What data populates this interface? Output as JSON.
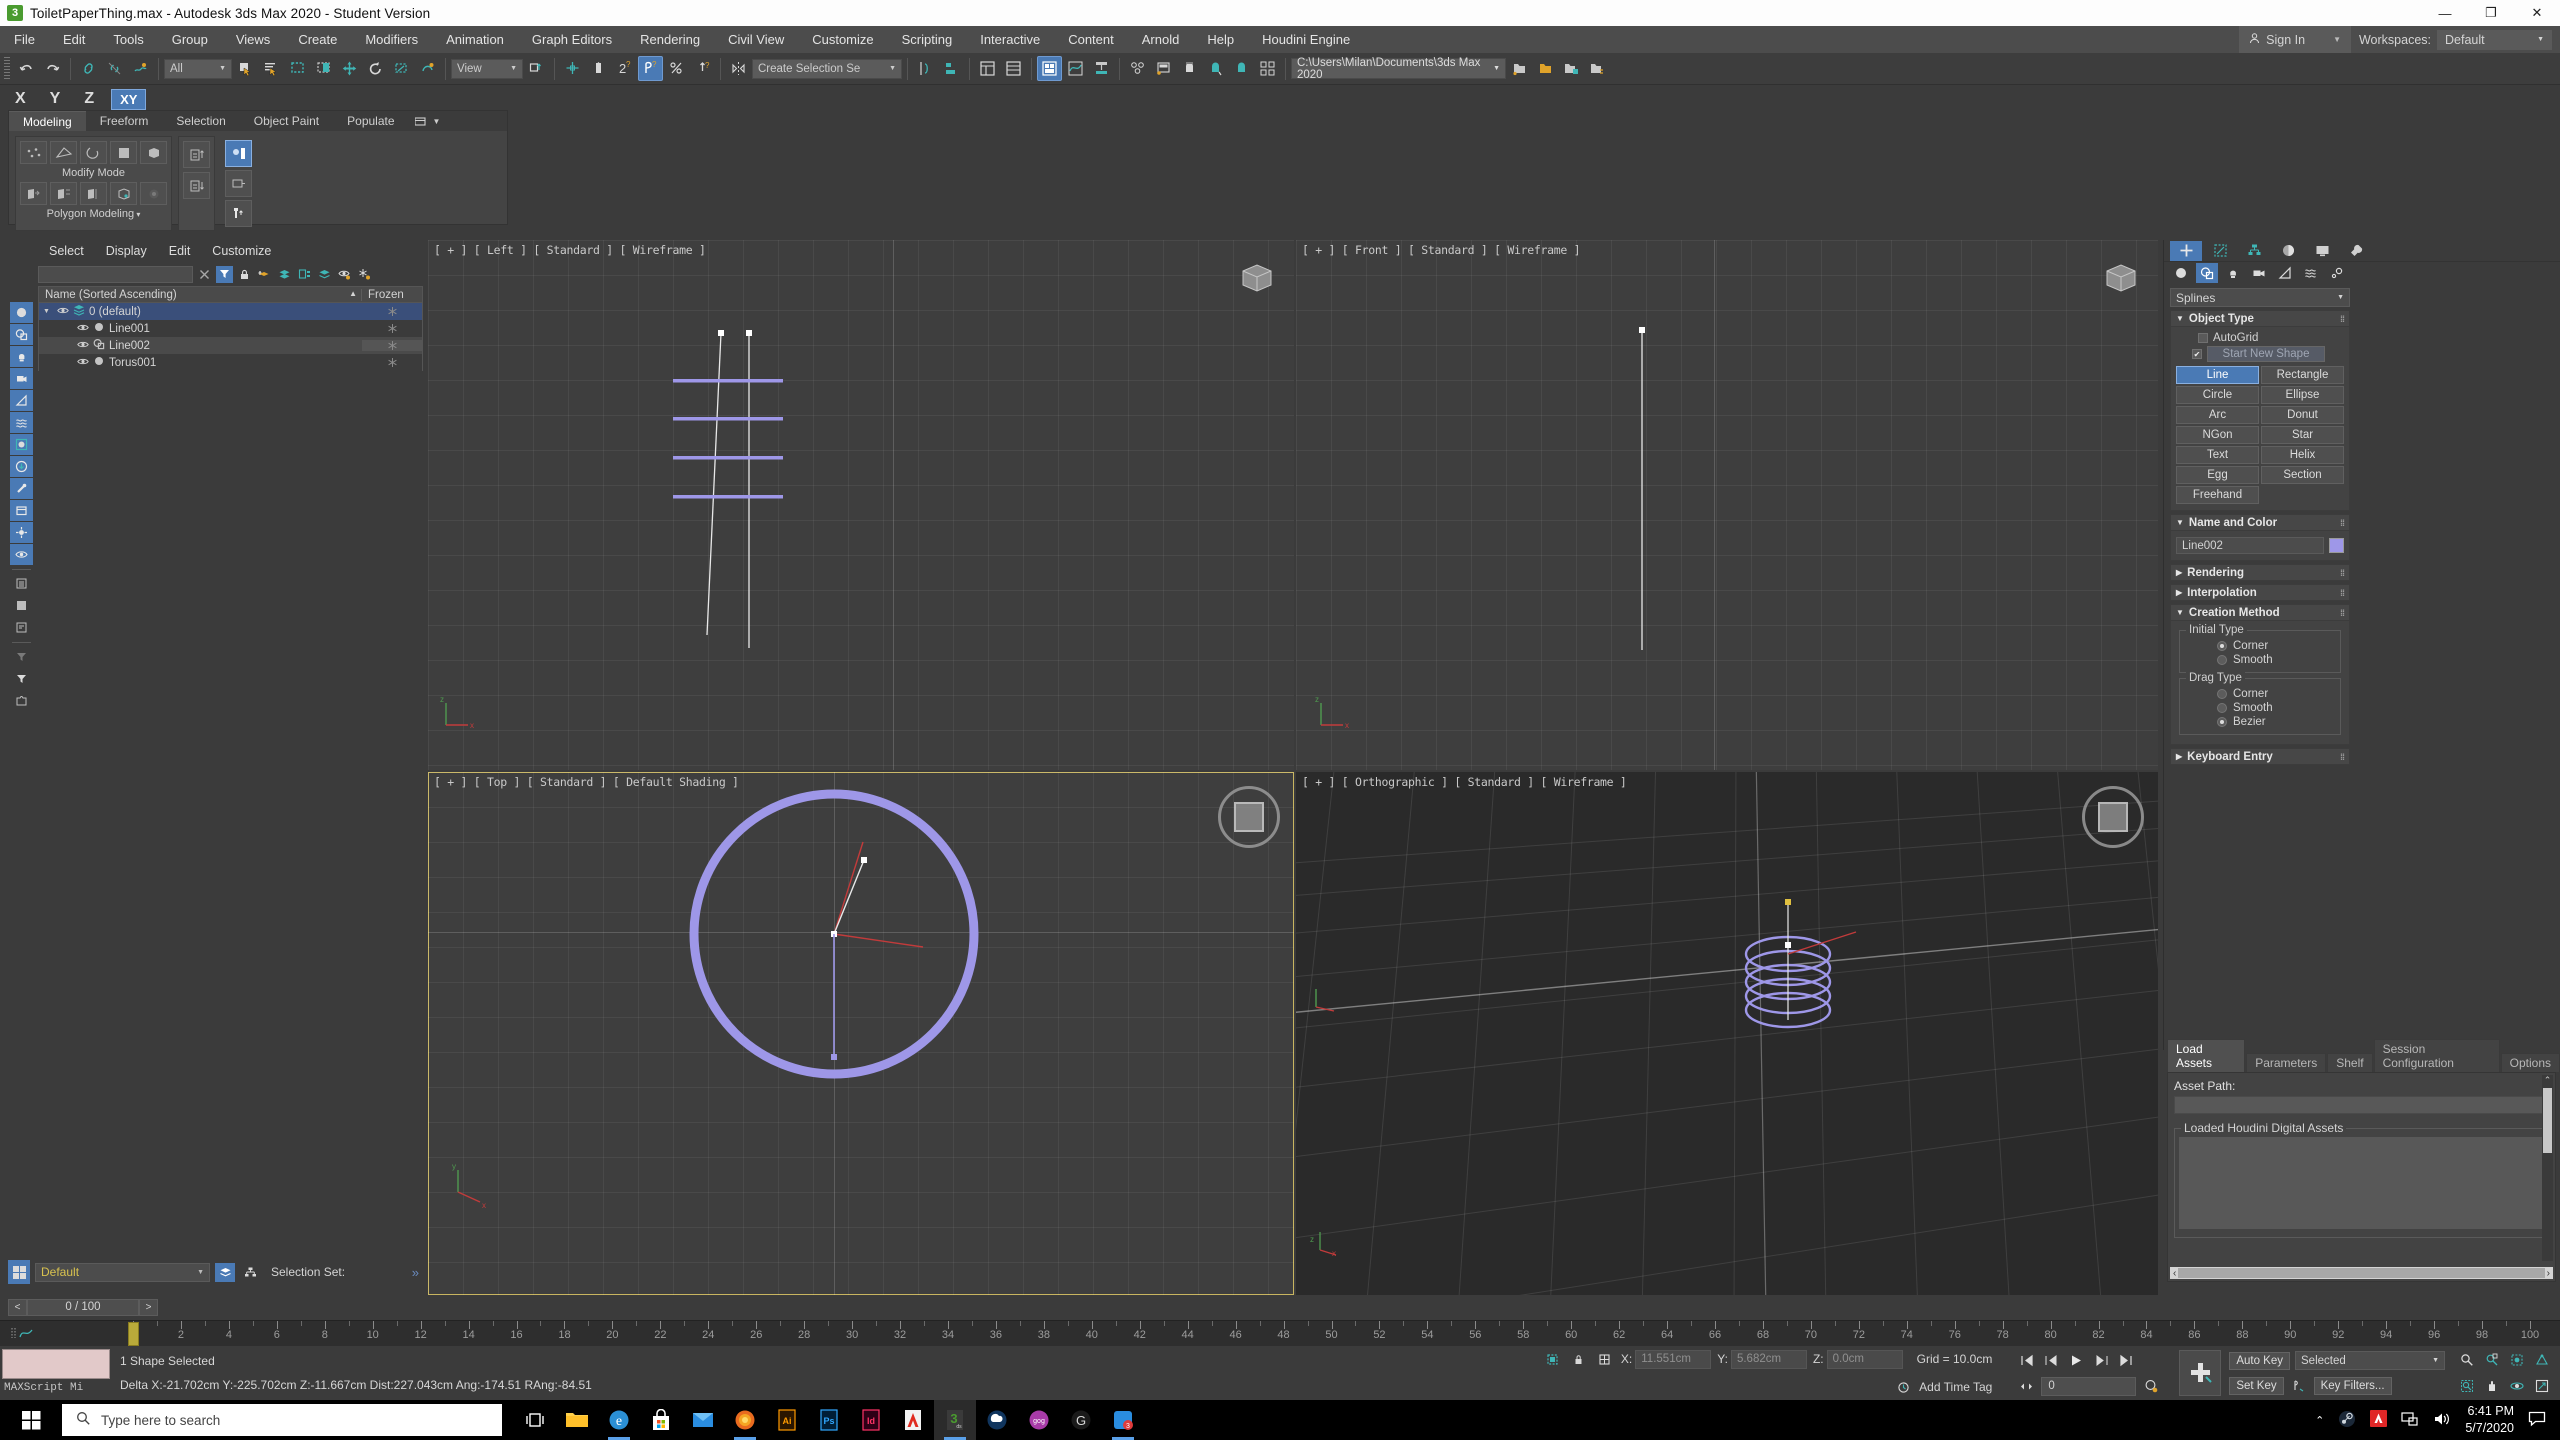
{
  "window": {
    "title": "ToiletPaperThing.max - Autodesk 3ds Max 2020 - Student Version",
    "app_badge": "3",
    "minimize": "—",
    "maximize": "❐",
    "close": "✕"
  },
  "menu": {
    "items": [
      "File",
      "Edit",
      "Tools",
      "Group",
      "Views",
      "Create",
      "Modifiers",
      "Animation",
      "Graph Editors",
      "Rendering",
      "Civil View",
      "Customize",
      "Scripting",
      "Interactive",
      "Content",
      "Arnold",
      "Help",
      "Houdini Engine"
    ],
    "signin_label": "Sign In",
    "workspaces_label": "Workspaces:",
    "workspaces_value": "Default"
  },
  "toolbar": {
    "selection_filter": "All",
    "reference_coord": "View",
    "named_selection_sets": "Create Selection Se",
    "project_path": "C:\\Users\\Milan\\Documents\\3ds Max 2020"
  },
  "moderow": {
    "x": "X",
    "y": "Y",
    "z": "Z",
    "xy": "XY"
  },
  "ribbon": {
    "tabs": [
      "Modeling",
      "Freeform",
      "Selection",
      "Object Paint",
      "Populate"
    ],
    "active_tab": "Modeling",
    "modify_mode_label": "Modify Mode",
    "polygon_modeling_label": "Polygon Modeling"
  },
  "explorer": {
    "menu": [
      "Select",
      "Display",
      "Edit",
      "Customize"
    ],
    "search_placeholder": "",
    "columns": [
      "Name (Sorted Ascending)",
      "Frozen"
    ],
    "sort_arrow": "▲",
    "rows": [
      {
        "label": "0 (default)",
        "indent": 0,
        "state": "selected",
        "icon": "layer-icon",
        "expander": "▼"
      },
      {
        "label": "Line001",
        "indent": 1,
        "state": "normal",
        "icon": "object-icon",
        "expander": ""
      },
      {
        "label": "Line002",
        "indent": 1,
        "state": "highlight",
        "icon": "shape-icon",
        "expander": ""
      },
      {
        "label": "Torus001",
        "indent": 1,
        "state": "normal",
        "icon": "object-icon",
        "expander": ""
      }
    ]
  },
  "viewports": [
    {
      "key": "vp-tl",
      "label": "[ + ] [ Left ] [ Standard ] [ Wireframe ]",
      "active": false
    },
    {
      "key": "vp-tr",
      "label": "[ + ] [ Front ] [ Standard ] [ Wireframe ]",
      "active": false
    },
    {
      "key": "vp-bl",
      "label": "[ + ] [ Top ] [ Standard ] [ Default Shading ]",
      "active": true
    },
    {
      "key": "vp-br",
      "label": "[ + ] [ Orthographic ] [ Standard ] [ Wireframe ]",
      "active": false
    }
  ],
  "command_panel": {
    "category": "Splines",
    "object_type": {
      "title": "Object Type",
      "autogrid_label": "AutoGrid",
      "autogrid_checked": false,
      "start_new_shape_label": "Start New Shape",
      "start_new_shape_checked": true,
      "buttons": [
        "Line",
        "Rectangle",
        "Circle",
        "Ellipse",
        "Arc",
        "Donut",
        "NGon",
        "Star",
        "Text",
        "Helix",
        "Egg",
        "Section",
        "Freehand"
      ],
      "active_button": "Line"
    },
    "name_and_color": {
      "title": "Name and Color",
      "name": "Line002",
      "color": "#9e97e8"
    },
    "rendering_title": "Rendering",
    "interpolation_title": "Interpolation",
    "creation_method": {
      "title": "Creation Method",
      "initial_type_label": "Initial Type",
      "initial_options": [
        "Corner",
        "Smooth"
      ],
      "initial_selected": "Corner",
      "drag_type_label": "Drag Type",
      "drag_options": [
        "Corner",
        "Smooth",
        "Bezier"
      ],
      "drag_selected": "Bezier"
    },
    "keyboard_entry_title": "Keyboard Entry"
  },
  "houdini": {
    "tabs": [
      "Load Assets",
      "Parameters",
      "Shelf",
      "Session Configuration",
      "Options"
    ],
    "active_tab": "Load Assets",
    "asset_path_label": "Asset Path:",
    "asset_path_value": "",
    "loaded_assets_label": "Loaded Houdini Digital Assets"
  },
  "bottom": {
    "layer_combo": "Default",
    "selection_set_label": "Selection Set:",
    "frame_range": "0 / 100",
    "timeline_ticks": [
      0,
      2,
      4,
      6,
      8,
      10,
      12,
      14,
      16,
      18,
      20,
      22,
      24,
      26,
      28,
      30,
      32,
      34,
      36,
      38,
      40,
      42,
      44,
      46,
      48,
      50,
      52,
      54,
      56,
      58,
      60,
      62,
      64,
      66,
      68,
      70,
      72,
      74,
      76,
      78,
      80,
      82,
      84,
      86,
      88,
      90,
      92,
      94,
      96,
      98,
      100
    ],
    "maxscript_label": "MAXScript Mi",
    "status_line1": "1 Shape Selected",
    "status_line2": "Delta X:-21.702cm  Y:-225.702cm  Z:-11.667cm  Dist:227.043cm Ang:-174.51 RAng:-84.51",
    "coord_x_label": "X:",
    "coord_x": "11.551cm",
    "coord_y_label": "Y:",
    "coord_y": "5.682cm",
    "coord_z_label": "Z:",
    "coord_z": "0.0cm",
    "grid_label": "Grid = 10.0cm",
    "add_time_tag": "Add Time Tag",
    "auto_key": "Auto Key",
    "set_key": "Set Key",
    "key_mode": "Selected",
    "key_filters": "Key Filters...",
    "current_frame": "0"
  },
  "taskbar": {
    "search_placeholder": "Type here to search",
    "apps": [
      {
        "name": "task-view-icon",
        "glyph": "",
        "color": "#ffffff"
      },
      {
        "name": "file-explorer-icon",
        "glyph": "",
        "color": "#ffd04a"
      },
      {
        "name": "edge-icon",
        "glyph": "e",
        "color": "#2b8fd4"
      },
      {
        "name": "microsoft-store-icon",
        "glyph": "",
        "color": "#ffffff"
      },
      {
        "name": "mail-icon",
        "glyph": "",
        "color": "#2a8de0"
      },
      {
        "name": "firefox-icon",
        "glyph": "",
        "color": "#e96b1f"
      },
      {
        "name": "illustrator-icon",
        "glyph": "Ai",
        "color": "#ff9a00"
      },
      {
        "name": "photoshop-icon",
        "glyph": "Ps",
        "color": "#31a8ff"
      },
      {
        "name": "indesign-icon",
        "glyph": "Id",
        "color": "#ff3366"
      },
      {
        "name": "autodesk-icon",
        "glyph": "A",
        "color": "#e02b20"
      },
      {
        "name": "3ds-max-icon",
        "glyph": "3",
        "color": "#4a9b2f"
      },
      {
        "name": "cloud-icon",
        "glyph": "",
        "color": "#1d5fa8"
      },
      {
        "name": "gogcom-icon",
        "glyph": "",
        "color": "#a83ba8"
      },
      {
        "name": "logitech-icon",
        "glyph": "G",
        "color": "#d8d8d8"
      },
      {
        "name": "chat-icon",
        "glyph": "",
        "color": "#2a8de0"
      }
    ],
    "tray": {
      "chevron": "⌃",
      "steam_icon": "steam-icon",
      "avira_icon": "avira-icon",
      "network_icon": "network-icon",
      "volume_icon": "volume-icon",
      "time": "6:41 PM",
      "date": "5/7/2020",
      "notifications_icon": "notification-icon"
    }
  },
  "colors": {
    "accent_blue": "#4a7ab5",
    "spline_purple": "#9e97e8",
    "active_viewport_border": "#c8b560",
    "teal": "#3fb6b6"
  }
}
